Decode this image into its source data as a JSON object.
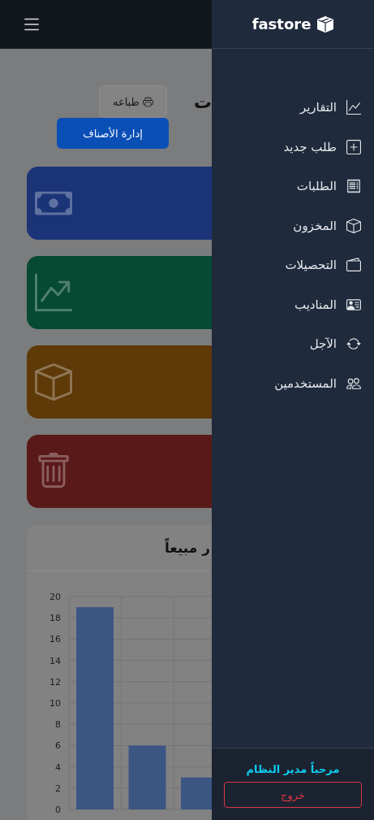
{
  "page": {
    "title": "ت",
    "print_button": "طباعه",
    "manage_button": "إدارة الأصناف",
    "cards": [
      {
        "kind": "cash",
        "color": "#1b3478"
      },
      {
        "kind": "growth",
        "color": "#064a33"
      },
      {
        "kind": "stock",
        "color": "#5e3a09"
      },
      {
        "kind": "trash",
        "color": "#5a1919"
      }
    ],
    "chart": {
      "title": "ر مبيعاً",
      "chart_data": {
        "type": "bar",
        "grid": true,
        "categories": [
          null,
          null,
          null
        ],
        "values": [
          19,
          6,
          3
        ],
        "ylim": [
          0,
          20
        ],
        "yticks": [
          0,
          2,
          4,
          6,
          8,
          10,
          12,
          14,
          16,
          18,
          20
        ]
      }
    }
  },
  "sidebar": {
    "brand": "fastore",
    "items": [
      {
        "label": "التقارير",
        "kind": "reports"
      },
      {
        "label": "طلب جديد",
        "kind": "new"
      },
      {
        "label": "الطلبات",
        "kind": "orders"
      },
      {
        "label": "المخزون",
        "kind": "stock"
      },
      {
        "label": "التحصيلات",
        "kind": "collections"
      },
      {
        "label": "المناديب",
        "kind": "agents"
      },
      {
        "label": "الآجل",
        "kind": "credit"
      },
      {
        "label": "المستخدمين",
        "kind": "users"
      }
    ],
    "welcome": "مرحباً مدير النظام",
    "logout": "خروج"
  }
}
